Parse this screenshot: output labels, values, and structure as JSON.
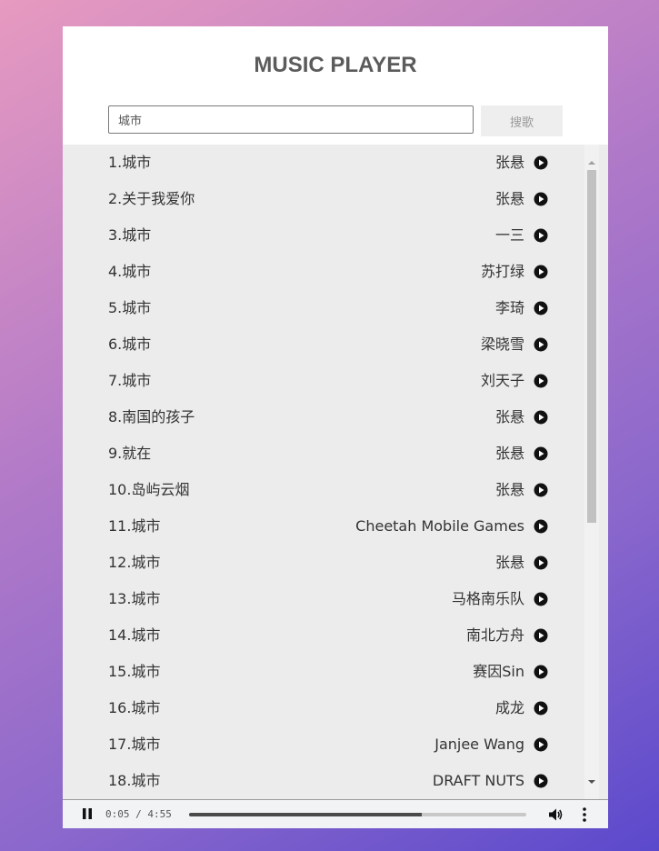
{
  "header": {
    "title": "MUSIC PLAYER"
  },
  "search": {
    "value": "城市",
    "button_label": "搜歌"
  },
  "songs": [
    {
      "name": "1.城市",
      "artist": "张悬"
    },
    {
      "name": "2.关于我爱你",
      "artist": "张悬"
    },
    {
      "name": "3.城市",
      "artist": "一三"
    },
    {
      "name": "4.城市",
      "artist": "苏打绿"
    },
    {
      "name": "5.城市",
      "artist": "李琦"
    },
    {
      "name": "6.城市",
      "artist": "梁晓雪"
    },
    {
      "name": "7.城市",
      "artist": "刘天子"
    },
    {
      "name": "8.南国的孩子",
      "artist": "张悬"
    },
    {
      "name": "9.就在",
      "artist": "张悬"
    },
    {
      "name": "10.岛屿云烟",
      "artist": "张悬"
    },
    {
      "name": "11.城市",
      "artist": "Cheetah Mobile Games"
    },
    {
      "name": "12.城市",
      "artist": "张悬"
    },
    {
      "name": "13.城市",
      "artist": "马格南乐队"
    },
    {
      "name": "14.城市",
      "artist": "南北方舟"
    },
    {
      "name": "15.城市",
      "artist": "赛因Sin"
    },
    {
      "name": "16.城市",
      "artist": "成龙"
    },
    {
      "name": "17.城市",
      "artist": "Janjee Wang"
    },
    {
      "name": "18.城市",
      "artist": "DRAFT NUTS"
    }
  ],
  "player": {
    "state_icon": "pause-icon",
    "time": "0:05 / 4:55",
    "progress": 0.69
  },
  "icons": {
    "row_action": "play-circle-icon",
    "volume": "volume-icon",
    "more": "more-vertical-icon"
  },
  "colors": {
    "accent_gradient_start": "#e79ac0",
    "accent_gradient_end": "#5b49cc"
  }
}
